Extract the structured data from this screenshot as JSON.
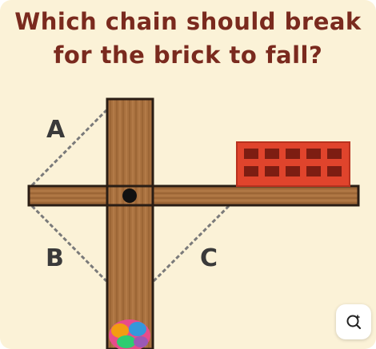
{
  "puzzle": {
    "title_line1": "Which chain should break",
    "title_line2": "for the brick to fall?",
    "labels": {
      "a": "A",
      "b": "B",
      "c": "C"
    }
  },
  "colors": {
    "background": "#fbf2d7",
    "title": "#7a2a1e",
    "wood": "#a9713f",
    "brick": "#e0442c",
    "mortar_hole": "#7d1d12"
  },
  "icons": {
    "logo": "brain-icon",
    "lens": "lens-search-icon"
  }
}
